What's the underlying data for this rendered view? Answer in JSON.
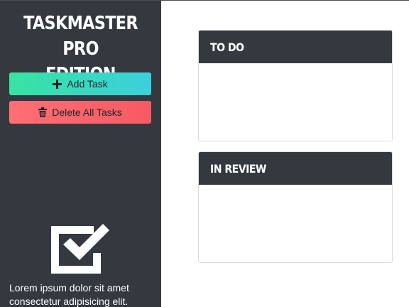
{
  "sidebar": {
    "title_line1": "TASKMASTER PRO",
    "title_line2": "EDITION",
    "add_button": {
      "label": "Add Task",
      "icon": "plus-icon"
    },
    "delete_button": {
      "label": "Delete All Tasks",
      "icon": "trash-icon"
    },
    "logo_icon": "checkbox-check-icon",
    "description": "Lorem ipsum dolor sit amet consectetur adipisicing elit."
  },
  "boards": [
    {
      "title": "TO DO"
    },
    {
      "title": "IN REVIEW"
    }
  ],
  "colors": {
    "sidebar_bg": "#343940",
    "add_gradient": [
      "#37e3a2",
      "#3ccfdc"
    ],
    "delete_gradient": [
      "#ff6f74",
      "#f75a63"
    ]
  }
}
